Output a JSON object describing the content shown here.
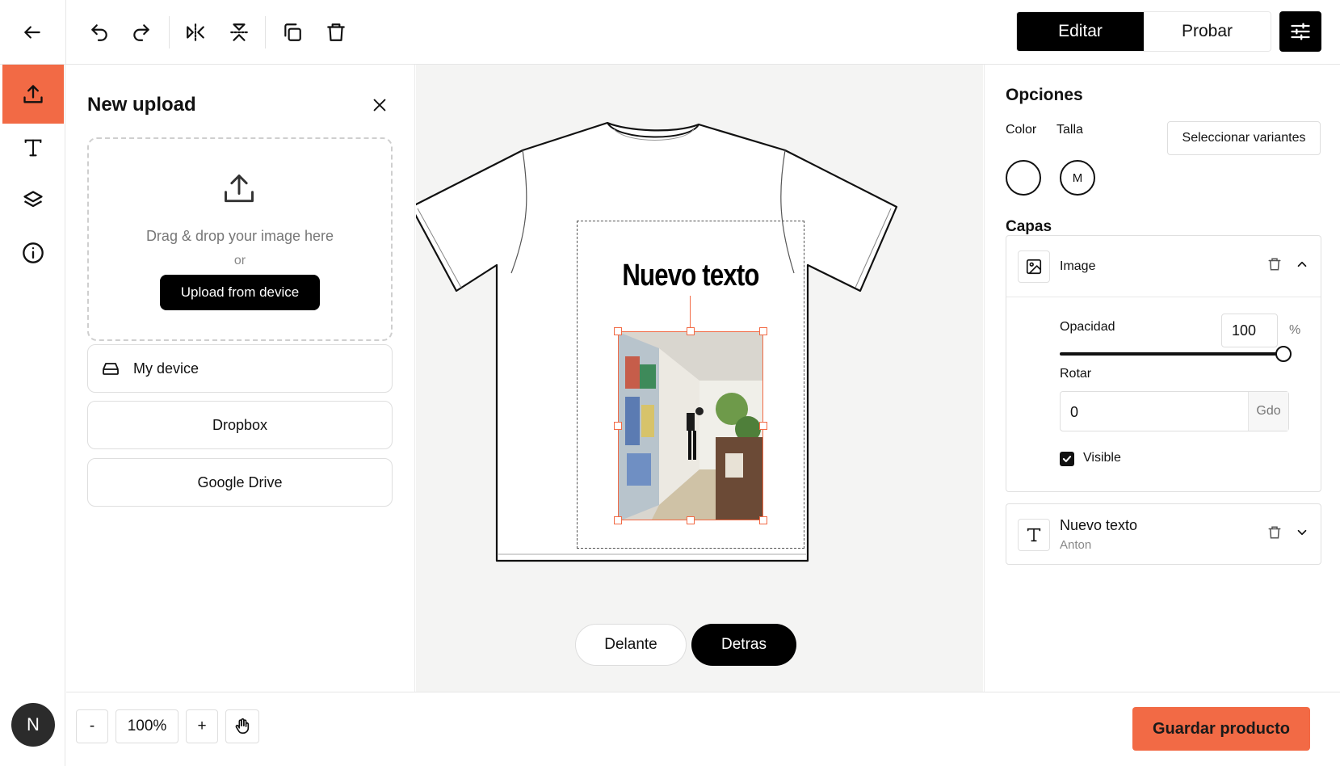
{
  "toolbar": {
    "mode_edit": "Editar",
    "mode_try": "Probar"
  },
  "rail": {
    "avatar_initial": "N"
  },
  "upload_panel": {
    "title": "New upload",
    "drop_text": "Drag & drop your image here",
    "or_text": "or",
    "upload_button": "Upload from device",
    "sources": [
      "My device",
      "Dropbox",
      "Google Drive"
    ]
  },
  "canvas": {
    "design_text": "Nuevo texto",
    "side_front": "Delante",
    "side_back": "Detras",
    "active_side": "Detras"
  },
  "options": {
    "title": "Opciones",
    "color_label": "Color",
    "size_label": "Talla",
    "variants_button": "Seleccionar variantes",
    "selected_color": "#ffffff",
    "selected_size": "M"
  },
  "layers": {
    "title": "Capas",
    "image_layer": {
      "name": "Image",
      "opacity_label": "Opacidad",
      "opacity_value": "100",
      "opacity_unit": "%",
      "rotate_label": "Rotar",
      "rotate_value": "0",
      "rotate_unit": "Gdo",
      "visible_label": "Visible",
      "visible": true
    },
    "text_layer": {
      "name": "Nuevo texto",
      "font": "Anton"
    }
  },
  "bottom": {
    "zoom_out": "-",
    "zoom_value": "100%",
    "zoom_in": "+",
    "save_button": "Guardar producto"
  },
  "colors": {
    "accent": "#f26a45",
    "primary": "#000000",
    "canvas_bg": "#f4f4f3"
  }
}
